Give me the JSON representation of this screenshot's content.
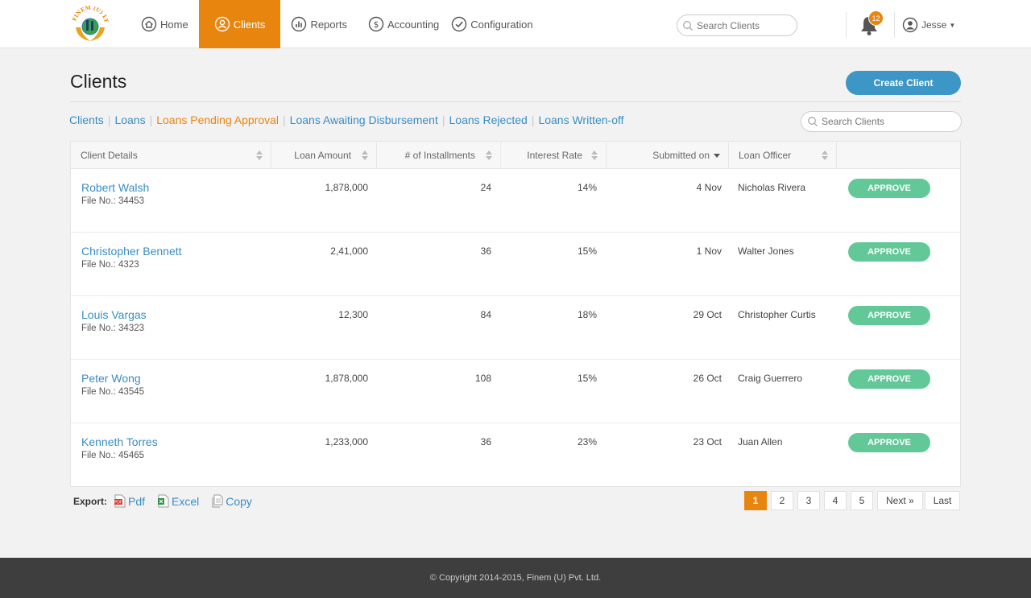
{
  "brand": {
    "logo_text": "FINEM (U) LTD",
    "accent": "#e8850e",
    "link": "#3a8dc4",
    "approve": "#63c897"
  },
  "nav": [
    {
      "label": "Home",
      "icon": "home-icon",
      "active": false
    },
    {
      "label": "Clients",
      "icon": "user-circle-icon",
      "active": true
    },
    {
      "label": "Reports",
      "icon": "chart-icon",
      "active": false
    },
    {
      "label": "Accounting",
      "icon": "dollar-icon",
      "active": false
    },
    {
      "label": "Configuration",
      "icon": "check-circle-icon",
      "active": false
    }
  ],
  "header": {
    "search_placeholder": "Search Clients",
    "notifications": "12",
    "user": "Jesse"
  },
  "page": {
    "title": "Clients",
    "create_button": "Create Client",
    "search_placeholder": "Search Clients",
    "tabs": [
      {
        "label": "Clients",
        "active": false
      },
      {
        "label": "Loans",
        "active": false
      },
      {
        "label": "Loans Pending Approval",
        "active": true
      },
      {
        "label": "Loans Awaiting Disbursement",
        "active": false
      },
      {
        "label": "Loans Rejected",
        "active": false
      },
      {
        "label": "Loans Written-off",
        "active": false
      }
    ]
  },
  "table": {
    "columns": [
      "Client Details",
      "Loan Amount",
      "# of Installments",
      "Interest Rate",
      "Submitted on",
      "Loan Officer",
      ""
    ],
    "approve_label": "APPROVE",
    "file_prefix": "File No.:",
    "rows": [
      {
        "name": "Robert Walsh",
        "file": "34453",
        "amount": "1,878,000",
        "installments": "24",
        "rate": "14%",
        "submitted": "4 Nov",
        "officer": "Nicholas Rivera"
      },
      {
        "name": "Christopher Bennett",
        "file": "4323",
        "amount": "2,41,000",
        "installments": "36",
        "rate": "15%",
        "submitted": "1 Nov",
        "officer": "Walter Jones"
      },
      {
        "name": "Louis Vargas",
        "file": "34323",
        "amount": "12,300",
        "installments": "84",
        "rate": "18%",
        "submitted": "29 Oct",
        "officer": "Christopher Curtis"
      },
      {
        "name": "Peter Wong",
        "file": "43545",
        "amount": "1,878,000",
        "installments": "108",
        "rate": "15%",
        "submitted": "26 Oct",
        "officer": "Craig Guerrero"
      },
      {
        "name": "Kenneth Torres",
        "file": "45465",
        "amount": "1,233,000",
        "installments": "36",
        "rate": "23%",
        "submitted": "23 Oct",
        "officer": "Juan Allen"
      }
    ]
  },
  "export": {
    "label": "Export:",
    "pdf": "Pdf",
    "excel": "Excel",
    "copy": "Copy"
  },
  "pagination": {
    "pages": [
      "1",
      "2",
      "3",
      "4",
      "5"
    ],
    "current": "1",
    "next": "Next »",
    "last": "Last"
  },
  "footer": {
    "copyright": "© Copyright 2014-2015, Finem (U) Pvt. Ltd."
  }
}
